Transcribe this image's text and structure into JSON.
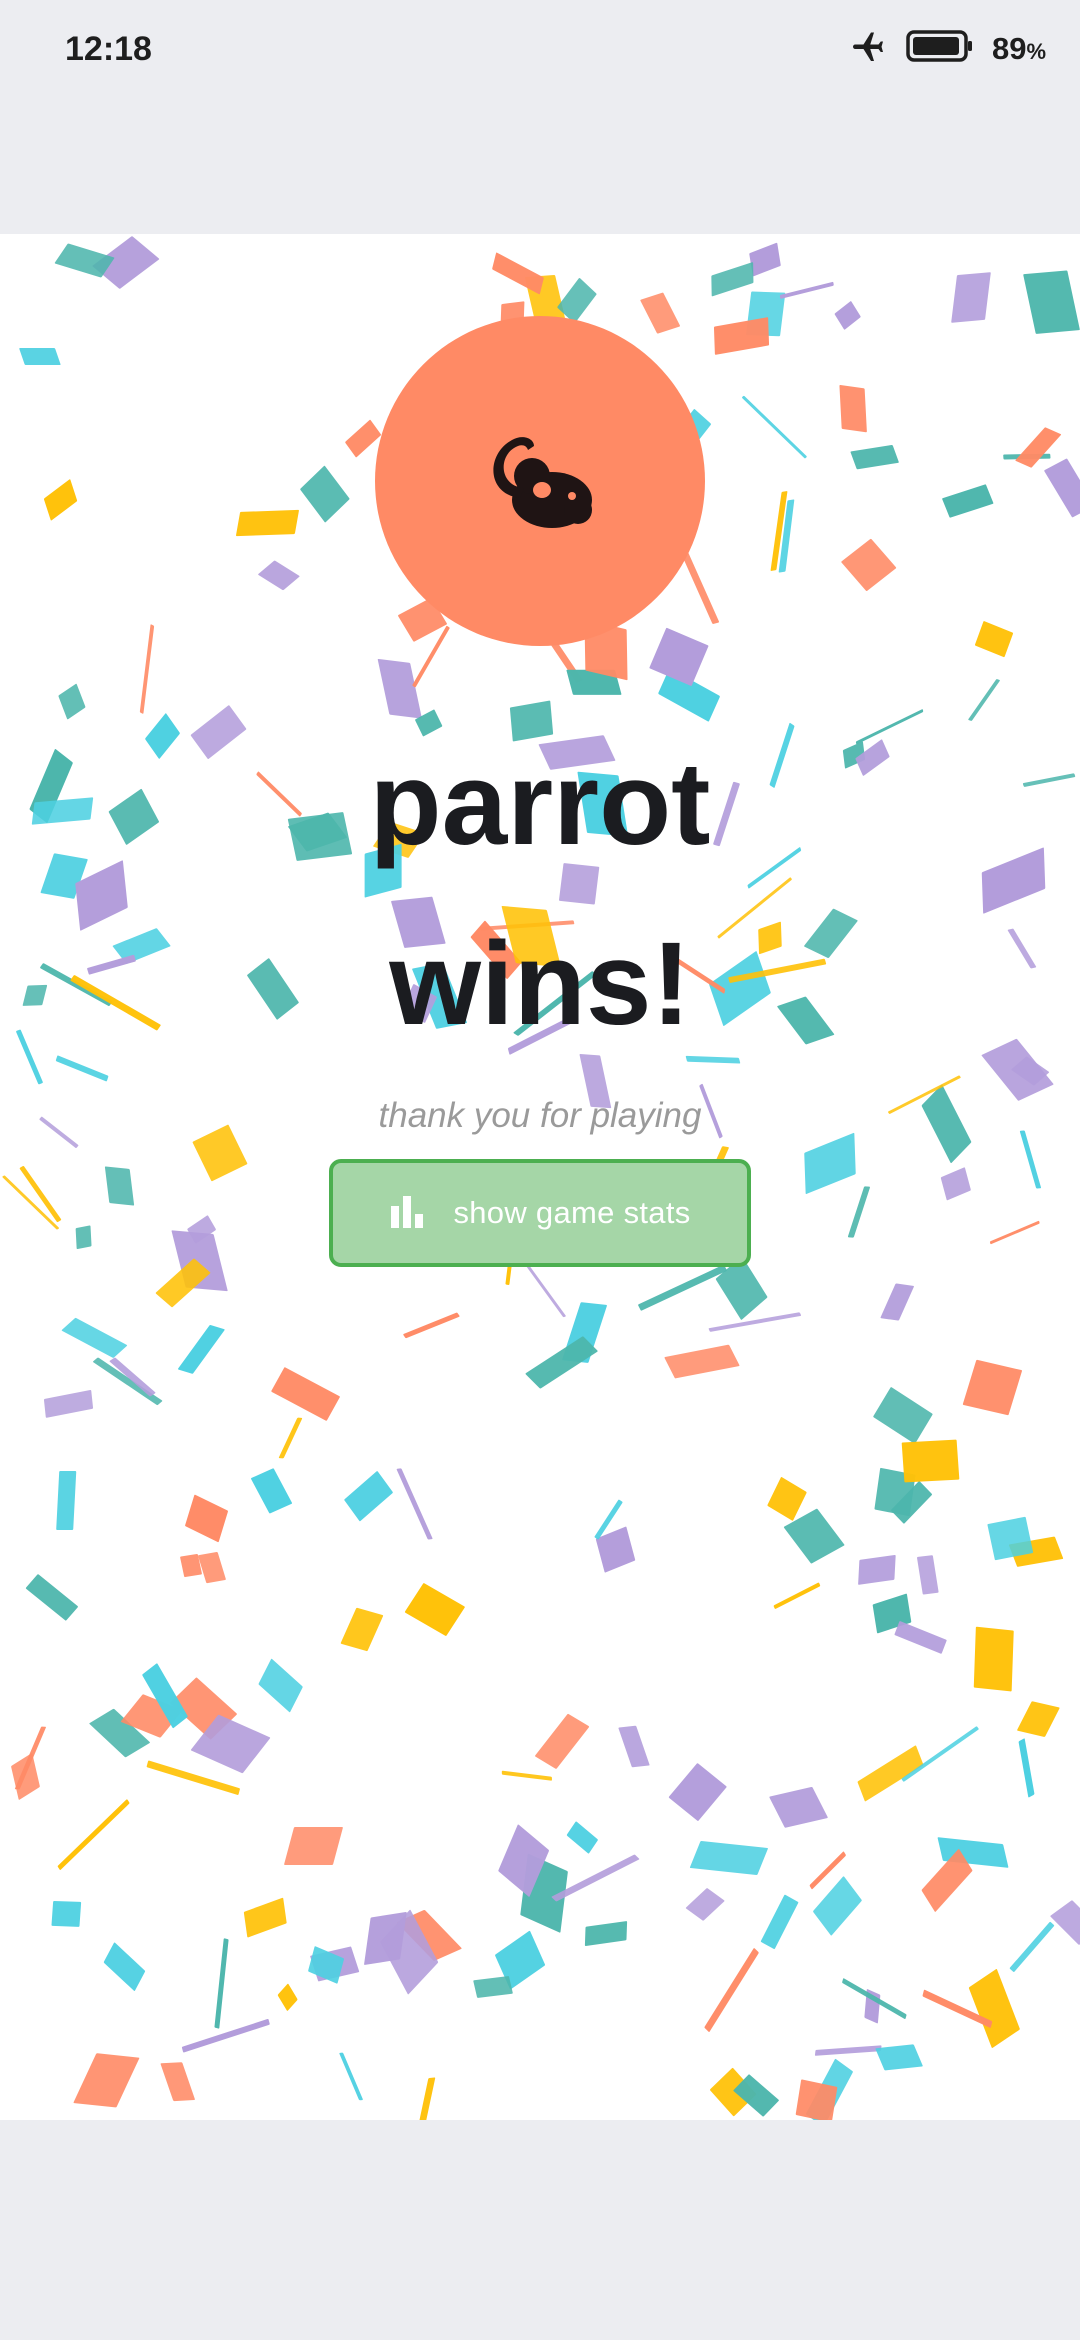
{
  "status_bar": {
    "time": "12:18",
    "battery_level": "89",
    "battery_unit": "%",
    "icons": [
      "airplane-mode-icon",
      "battery-icon"
    ]
  },
  "winner": {
    "avatar_icon": "mouse-icon",
    "avatar_color": "#ff8a65",
    "name_line": "parrot",
    "result_line": "wins!"
  },
  "subtitle": "thank you for playing",
  "stats_button": {
    "label": "show game stats",
    "icon": "bar-chart-icon",
    "fill_color": "#a5d6a7",
    "border_color": "#4caf50"
  },
  "confetti_colors": [
    "#4dd0e1",
    "#4db6ac",
    "#ffc107",
    "#ff8a65",
    "#b39ddb"
  ]
}
